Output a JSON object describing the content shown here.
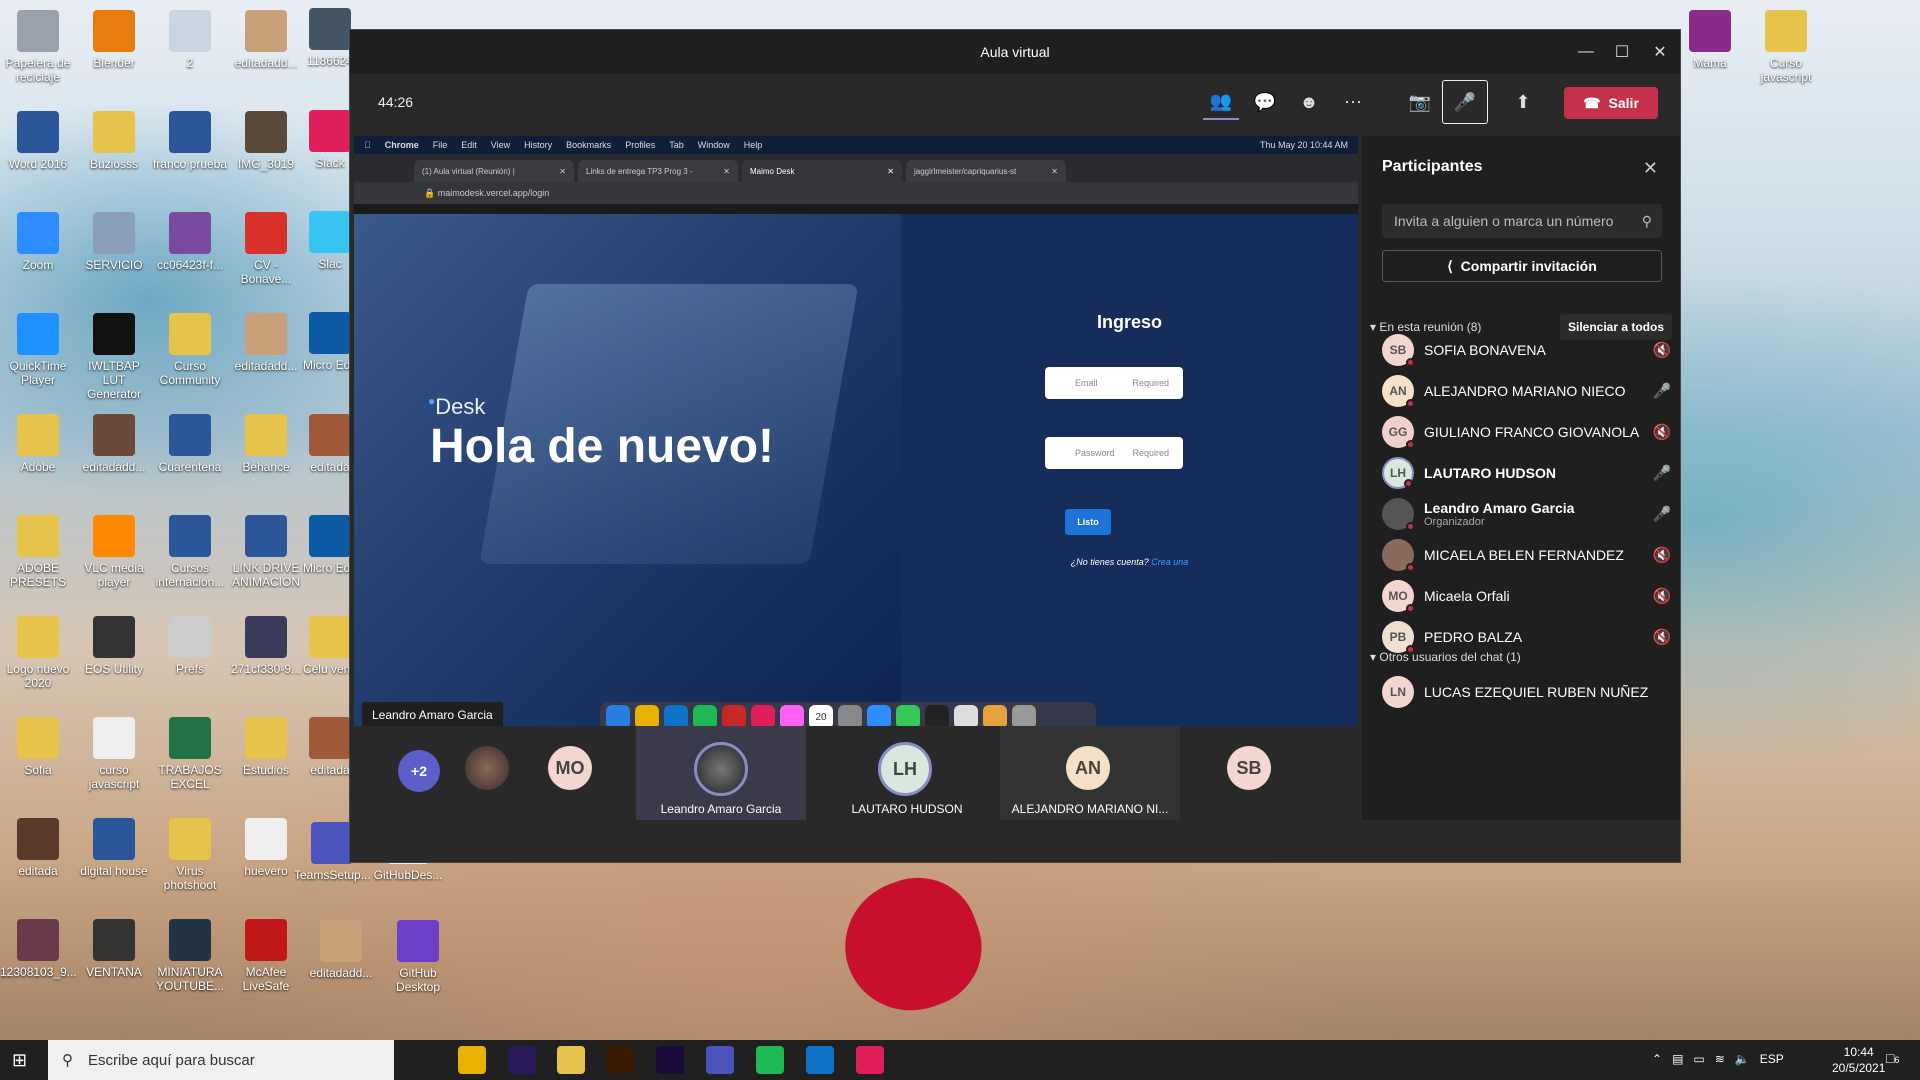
{
  "desktop": {
    "icons_left": [
      {
        "label": "Papelera de reciclaje",
        "icon": "recycle-bin-icon",
        "color": "#9aa3ad"
      },
      {
        "label": "Blender",
        "icon": "blender-icon",
        "color": "#e87d0d"
      },
      {
        "label": "2",
        "icon": "image-file-icon",
        "color": "#c9d6e2"
      },
      {
        "label": "editadadd...",
        "icon": "image-file-icon",
        "color": "#c8a07a"
      },
      {
        "label": "Word 2016",
        "icon": "word-icon",
        "color": "#2b579a"
      },
      {
        "label": "Buziosss",
        "icon": "folder-icon",
        "color": "#e6c34a"
      },
      {
        "label": "franco prueba",
        "icon": "word-icon",
        "color": "#2b579a"
      },
      {
        "label": "IMG_3019",
        "icon": "image-file-icon",
        "color": "#5b4a3a"
      },
      {
        "label": "Zoom",
        "icon": "zoom-icon",
        "color": "#2d8cff"
      },
      {
        "label": "SERVICIO",
        "icon": "image-file-icon",
        "color": "#8aa0b8"
      },
      {
        "label": "cc06423f-f...",
        "icon": "image-file-icon",
        "color": "#7a4aa0"
      },
      {
        "label": "CV - Bonave...",
        "icon": "pdf-icon",
        "color": "#d9302c"
      },
      {
        "label": "QuickTime Player",
        "icon": "quicktime-icon",
        "color": "#1e90ff"
      },
      {
        "label": "IWLTBAP LUT Generator",
        "icon": "lut-generator-icon",
        "color": "#111111"
      },
      {
        "label": "Curso Community",
        "icon": "folder-icon",
        "color": "#e6c34a"
      },
      {
        "label": "editadadd...",
        "icon": "image-file-icon",
        "color": "#c8a07a"
      },
      {
        "label": "Adobe",
        "icon": "folder-icon",
        "color": "#e6c34a"
      },
      {
        "label": "editadadd...",
        "icon": "image-file-icon",
        "color": "#6b4a3a"
      },
      {
        "label": "Cuarentena",
        "icon": "word-icon",
        "color": "#2b579a"
      },
      {
        "label": "Behance",
        "icon": "folder-icon",
        "color": "#e6c34a"
      },
      {
        "label": "ADOBE PRESETS",
        "icon": "folder-icon",
        "color": "#e6c34a"
      },
      {
        "label": "VLC media player",
        "icon": "vlc-icon",
        "color": "#ff8800"
      },
      {
        "label": "Cursos internacion...",
        "icon": "word-icon",
        "color": "#2b579a"
      },
      {
        "label": "LINK DRIVE ANIMACION",
        "icon": "word-icon",
        "color": "#2b579a"
      },
      {
        "label": "Logo nuevo 2020",
        "icon": "folder-icon",
        "color": "#e6c34a"
      },
      {
        "label": "EOS Utility",
        "icon": "camera-icon",
        "color": "#333333"
      },
      {
        "label": "Prefs",
        "icon": "gear-file-icon",
        "color": "#cccccc"
      },
      {
        "label": "271cf330-9...",
        "icon": "image-file-icon",
        "color": "#3a3a5a"
      },
      {
        "label": "Sofia",
        "icon": "folder-icon",
        "color": "#e6c34a"
      },
      {
        "label": "curso javascript",
        "icon": "text-file-icon",
        "color": "#eeeeee"
      },
      {
        "label": "TRABAJOS EXCEL",
        "icon": "excel-icon",
        "color": "#217346"
      },
      {
        "label": "Estudios",
        "icon": "folder-icon",
        "color": "#e6c34a"
      },
      {
        "label": "editada",
        "icon": "image-file-icon",
        "color": "#5a3a2a"
      },
      {
        "label": "digital house",
        "icon": "word-icon",
        "color": "#2b579a"
      },
      {
        "label": "Virus photshoot",
        "icon": "folder-icon",
        "color": "#e6c34a"
      },
      {
        "label": "huevero",
        "icon": "image-file-icon",
        "color": "#eeeeee"
      },
      {
        "label": "12308103_9...",
        "icon": "image-file-icon",
        "color": "#6a3a4a"
      },
      {
        "label": "VENTANA",
        "icon": "folder-icon",
        "color": "#333333"
      },
      {
        "label": "MINIATURA YOUTUBE...",
        "icon": "image-file-icon",
        "color": "#223344"
      },
      {
        "label": "McAfee LiveSafe",
        "icon": "mcafee-icon",
        "color": "#c01818"
      }
    ],
    "icons_partial": [
      {
        "label": "1186624",
        "icon": "image-file-icon",
        "color": "#445566"
      },
      {
        "label": "Slack",
        "icon": "slack-icon",
        "color": "#e01e5a"
      },
      {
        "label": "Slac",
        "icon": "slack-icon",
        "color": "#36c5f0"
      },
      {
        "label": "Micro Edg",
        "icon": "edge-icon",
        "color": "#0c59a4"
      },
      {
        "label": "editada",
        "icon": "image-file-icon",
        "color": "#a05a3a"
      },
      {
        "label": "Micro Edg",
        "icon": "edge-icon",
        "color": "#0c59a4"
      },
      {
        "label": "Celu vend",
        "icon": "folder-icon",
        "color": "#e6c34a"
      },
      {
        "label": "editada",
        "icon": "image-file-icon",
        "color": "#a05a3a"
      },
      {
        "label": "TeamsSetup...",
        "icon": "teams-setup-icon",
        "color": "#4b53bc"
      },
      {
        "label": "GitHubDes...",
        "icon": "app-icon",
        "color": "#eeeeee"
      },
      {
        "label": "editadadd...",
        "icon": "image-file-icon",
        "color": "#c8a07a"
      },
      {
        "label": "GitHub Desktop",
        "icon": "github-icon",
        "color": "#6e40c9"
      }
    ],
    "icons_right": [
      {
        "label": "Mama",
        "icon": "rar-file-icon",
        "color": "#8a2b8a"
      },
      {
        "label": "Curso javascript",
        "icon": "chrome-file-icon",
        "color": "#e6c34a"
      }
    ]
  },
  "window": {
    "title": "Aula virtual",
    "timer": "44:26",
    "leave_label": "Salir"
  },
  "shared": {
    "menubar": [
      "Chrome",
      "File",
      "Edit",
      "View",
      "History",
      "Bookmarks",
      "Profiles",
      "Tab",
      "Window",
      "Help"
    ],
    "menubar_time": "Thu May 20  10:44 AM",
    "tabs": [
      "(1) Aula virtual (Reunión) |",
      "Links de entrega TP3 Prog 3 -",
      "Maimo Desk",
      "jaggirlmeister/capriquarius-st"
    ],
    "url": "maimodesk.vercel.app/login",
    "brand": "Desk",
    "headline": "Hola de nuevo!",
    "login_title": "Ingreso",
    "email_label": "Email",
    "password_label": "Password",
    "required": "Required",
    "submit": "Listo",
    "no_account": "¿No tienes cuenta?",
    "create_link": "Crea una",
    "presenter": "Leandro Amaro Garcia",
    "dock_date": "20"
  },
  "strip": {
    "more": "+2",
    "tiles": [
      {
        "initials": "MO"
      },
      {
        "initials": "",
        "label": "Leandro Amaro Garcia"
      },
      {
        "initials": "LH",
        "label": "LAUTARO HUDSON"
      },
      {
        "initials": "AN",
        "label": "ALEJANDRO MARIANO NI..."
      },
      {
        "initials": "SB"
      }
    ]
  },
  "panel": {
    "title": "Participantes",
    "search_placeholder": "Invita a alguien o marca un número",
    "invite_label": "Compartir invitación",
    "in_meeting": "En esta reunión (8)",
    "mute_all": "Silenciar a todos",
    "participants": [
      {
        "initials": "SB",
        "name": "SOFIA BONAVENA",
        "mic": "muted",
        "color": "#f3d6d0"
      },
      {
        "initials": "AN",
        "name": "ALEJANDRO MARIANO NIECO",
        "mic": "on",
        "color": "#f5e1c8"
      },
      {
        "initials": "GG",
        "name": "GIULIANO FRANCO GIOVANOLA",
        "mic": "muted",
        "color": "#f0d0cc"
      },
      {
        "initials": "LH",
        "name": "LAUTARO HUDSON",
        "mic": "on",
        "color": "#d8e8dc"
      },
      {
        "initials": "",
        "name": "Leandro Amaro Garcia",
        "sub": "Organizador",
        "mic": "on",
        "color": "#555555"
      },
      {
        "initials": "",
        "name": "MICAELA BELEN FERNANDEZ",
        "mic": "muted",
        "color": "#8a6a5a"
      },
      {
        "initials": "MO",
        "name": "Micaela Orfali",
        "mic": "muted",
        "color": "#f3d6d0"
      },
      {
        "initials": "PB",
        "name": "PEDRO BALZA",
        "mic": "muted",
        "color": "#f0e0d0"
      }
    ],
    "others": "Otros usuarios del chat (1)",
    "other_users": [
      {
        "initials": "LN",
        "name": "LUCAS EZEQUIEL RUBEN NUÑEZ",
        "color": "#f3d6d0"
      }
    ]
  },
  "taskbar": {
    "search_placeholder": "Escribe aquí para buscar",
    "time": "10:44",
    "date": "20/5/2021",
    "lang": "ESP",
    "notifications": "6"
  }
}
